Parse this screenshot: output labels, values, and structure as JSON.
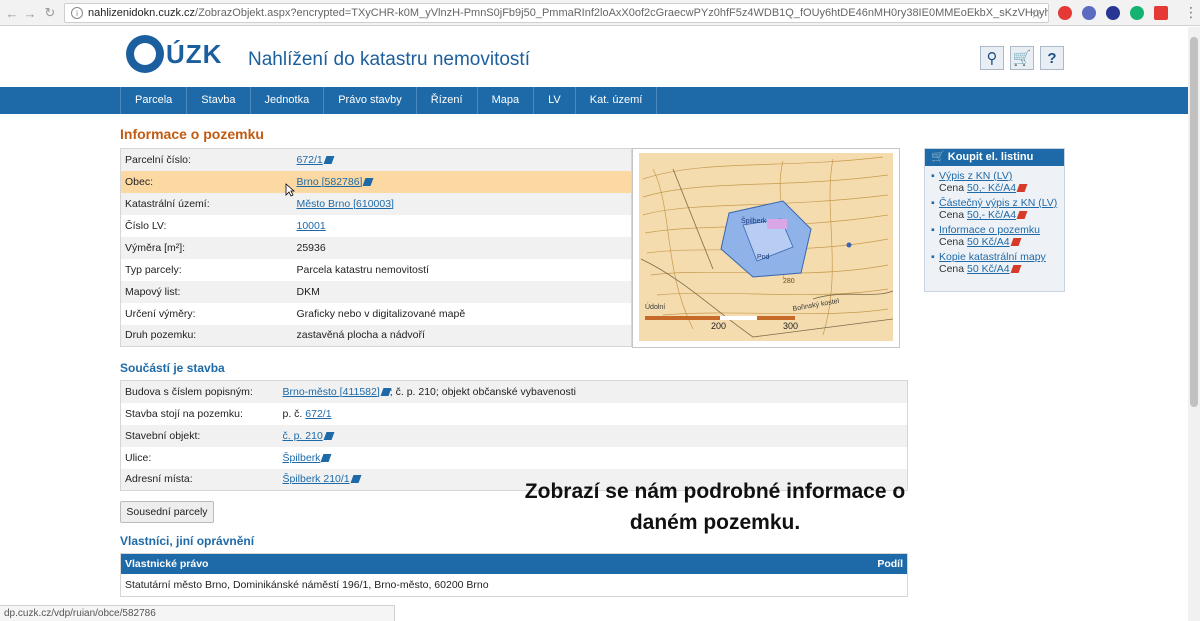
{
  "browser": {
    "url_host": "nahlizenidokn.cuzk.cz",
    "url_rest": "/ZobrazObjekt.aspx?encrypted=TXyCHR-k0M_yVlnzH-PmnS0jFb9j50_PmmaRInf2loAxX0of2cGraecwPYz0hfF5z4WDB1Q_fOUy6htDE46nMH0ry38IE0MMEoEkbX_sKzVHuyh..."
  },
  "header": {
    "logo_text": "ÚZK",
    "site_title": "Nahlížení do katastru nemovitostí"
  },
  "nav": [
    "Parcela",
    "Stavba",
    "Jednotka",
    "Právo stavby",
    "Řízení",
    "Mapa",
    "LV",
    "Kat. území"
  ],
  "parcel": {
    "heading": "Informace o pozemku",
    "rows": [
      {
        "label": "Parcelní číslo:",
        "value": "672/1",
        "link": true,
        "ext": true
      },
      {
        "label": "Obec:",
        "value": "Brno [582786]",
        "link": true,
        "ext": true
      },
      {
        "label": "Katastrální území:",
        "value": "Město Brno [610003]",
        "link": true,
        "ext": false
      },
      {
        "label": "Číslo LV:",
        "value": "10001",
        "link": true,
        "ext": false
      },
      {
        "label": "Výměra [m²]:",
        "value": "25936",
        "link": false,
        "ext": false
      },
      {
        "label": "Typ parcely:",
        "value": "Parcela katastru nemovitostí",
        "link": false,
        "ext": false
      },
      {
        "label": "Mapový list:",
        "value": "DKM",
        "link": false,
        "ext": false
      },
      {
        "label": "Určení výměry:",
        "value": "Graficky nebo v digitalizované mapě",
        "link": false,
        "ext": false
      },
      {
        "label": "Druh pozemku:",
        "value": "zastavěná plocha a nádvoří",
        "link": false,
        "ext": false
      }
    ]
  },
  "map": {
    "labels": [
      "Špilberk",
      "Pod",
      "280",
      "Bořinský kostel",
      "200",
      "300",
      "Údolní"
    ]
  },
  "building": {
    "heading": "Součástí je stavba",
    "rows": [
      {
        "label": "Budova s číslem popisným:",
        "link": "Brno-město [411582]",
        "suffix": "; č. p. 210; objekt občanské vybavenosti"
      },
      {
        "label": "Stavba stojí na pozemku:",
        "prefix": "p. č.",
        "link": "672/1",
        "suffix": ""
      },
      {
        "label": "Stavební objekt:",
        "link": "č. p. 210",
        "suffix": ""
      },
      {
        "label": "Ulice:",
        "link": "Špilberk",
        "suffix": ""
      },
      {
        "label": "Adresní místa:",
        "link": "Špilberk 210/1",
        "suffix": ""
      }
    ]
  },
  "neighbours_button": "Sousední parcely",
  "owners": {
    "heading": "Vlastníci, jiní oprávnění",
    "col_right": "Vlastnické právo",
    "col_share": "Podíl",
    "row": "Statutární město Brno, Dominikánské náměstí 196/1, Brno-město, 60200 Brno"
  },
  "purchase": {
    "heading": "Koupit el. listinu",
    "items": [
      {
        "title": "Výpis z KN (LV)",
        "price_label": "Cena",
        "price": "50,- Kč/A4"
      },
      {
        "title": "Částečný výpis z KN (LV)",
        "price_label": "Cena",
        "price": "50,- Kč/A4"
      },
      {
        "title": "Informace o pozemku",
        "price_label": "Cena",
        "price": "50 Kč/A4"
      },
      {
        "title": "Kopie katastrální mapy",
        "price_label": "Cena",
        "price": "50 Kč/A4"
      }
    ]
  },
  "subtitle": [
    "Zobrazí se nám podrobné informace o",
    "daném pozemku."
  ],
  "status_bar": "dp.cuzk.cz/vdp/ruian/obce/582786",
  "colors": {
    "brand_blue": "#1e6aa8",
    "heading_orange": "#c25b12",
    "highlight_row": "#fcd9a3"
  }
}
